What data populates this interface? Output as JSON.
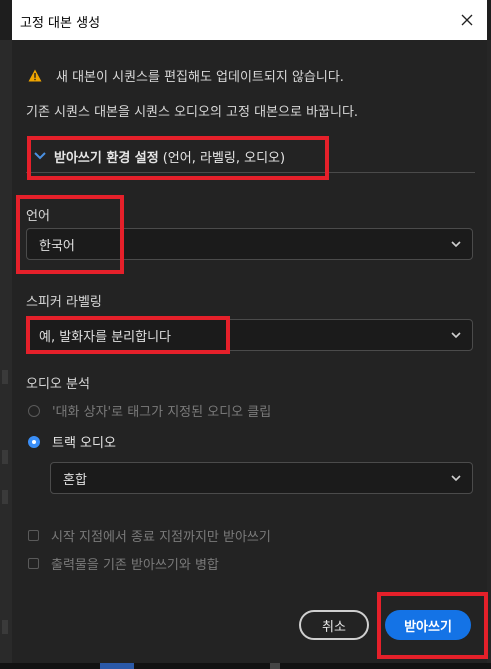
{
  "dialog": {
    "title": "고정 대본 생성",
    "warning": "새 대본이 시퀀스를 편집해도 업데이트되지 않습니다.",
    "description": "기존 시퀀스 대본을 시퀀스 오디오의 고정 대본으로 바꿉니다.",
    "section": {
      "title": "받아쓰기 환경 설정",
      "subtitle": "(언어, 라벨링, 오디오)"
    },
    "language": {
      "label": "언어",
      "value": "한국어"
    },
    "speaker": {
      "label": "스피커 라벨링",
      "value": "예, 발화자를 분리합니다"
    },
    "audio": {
      "label": "오디오 분석",
      "options": [
        {
          "label": "'대화 상자'로 태그가 지정된 오디오 클립",
          "selected": false,
          "enabled": false
        },
        {
          "label": "트랙 오디오",
          "selected": true,
          "enabled": true
        }
      ],
      "track_mix": "혼합"
    },
    "checkboxes": [
      {
        "label": "시작 지점에서 종료 지점까지만 받아쓰기",
        "checked": false,
        "enabled": false
      },
      {
        "label": "출력물을 기존 받아쓰기와 병합",
        "checked": false,
        "enabled": false
      }
    ],
    "buttons": {
      "cancel": "취소",
      "transcribe": "받아쓰기"
    },
    "colors": {
      "accent": "#1473e6",
      "highlight": "#e5202a",
      "warning": "#f0a500"
    }
  }
}
